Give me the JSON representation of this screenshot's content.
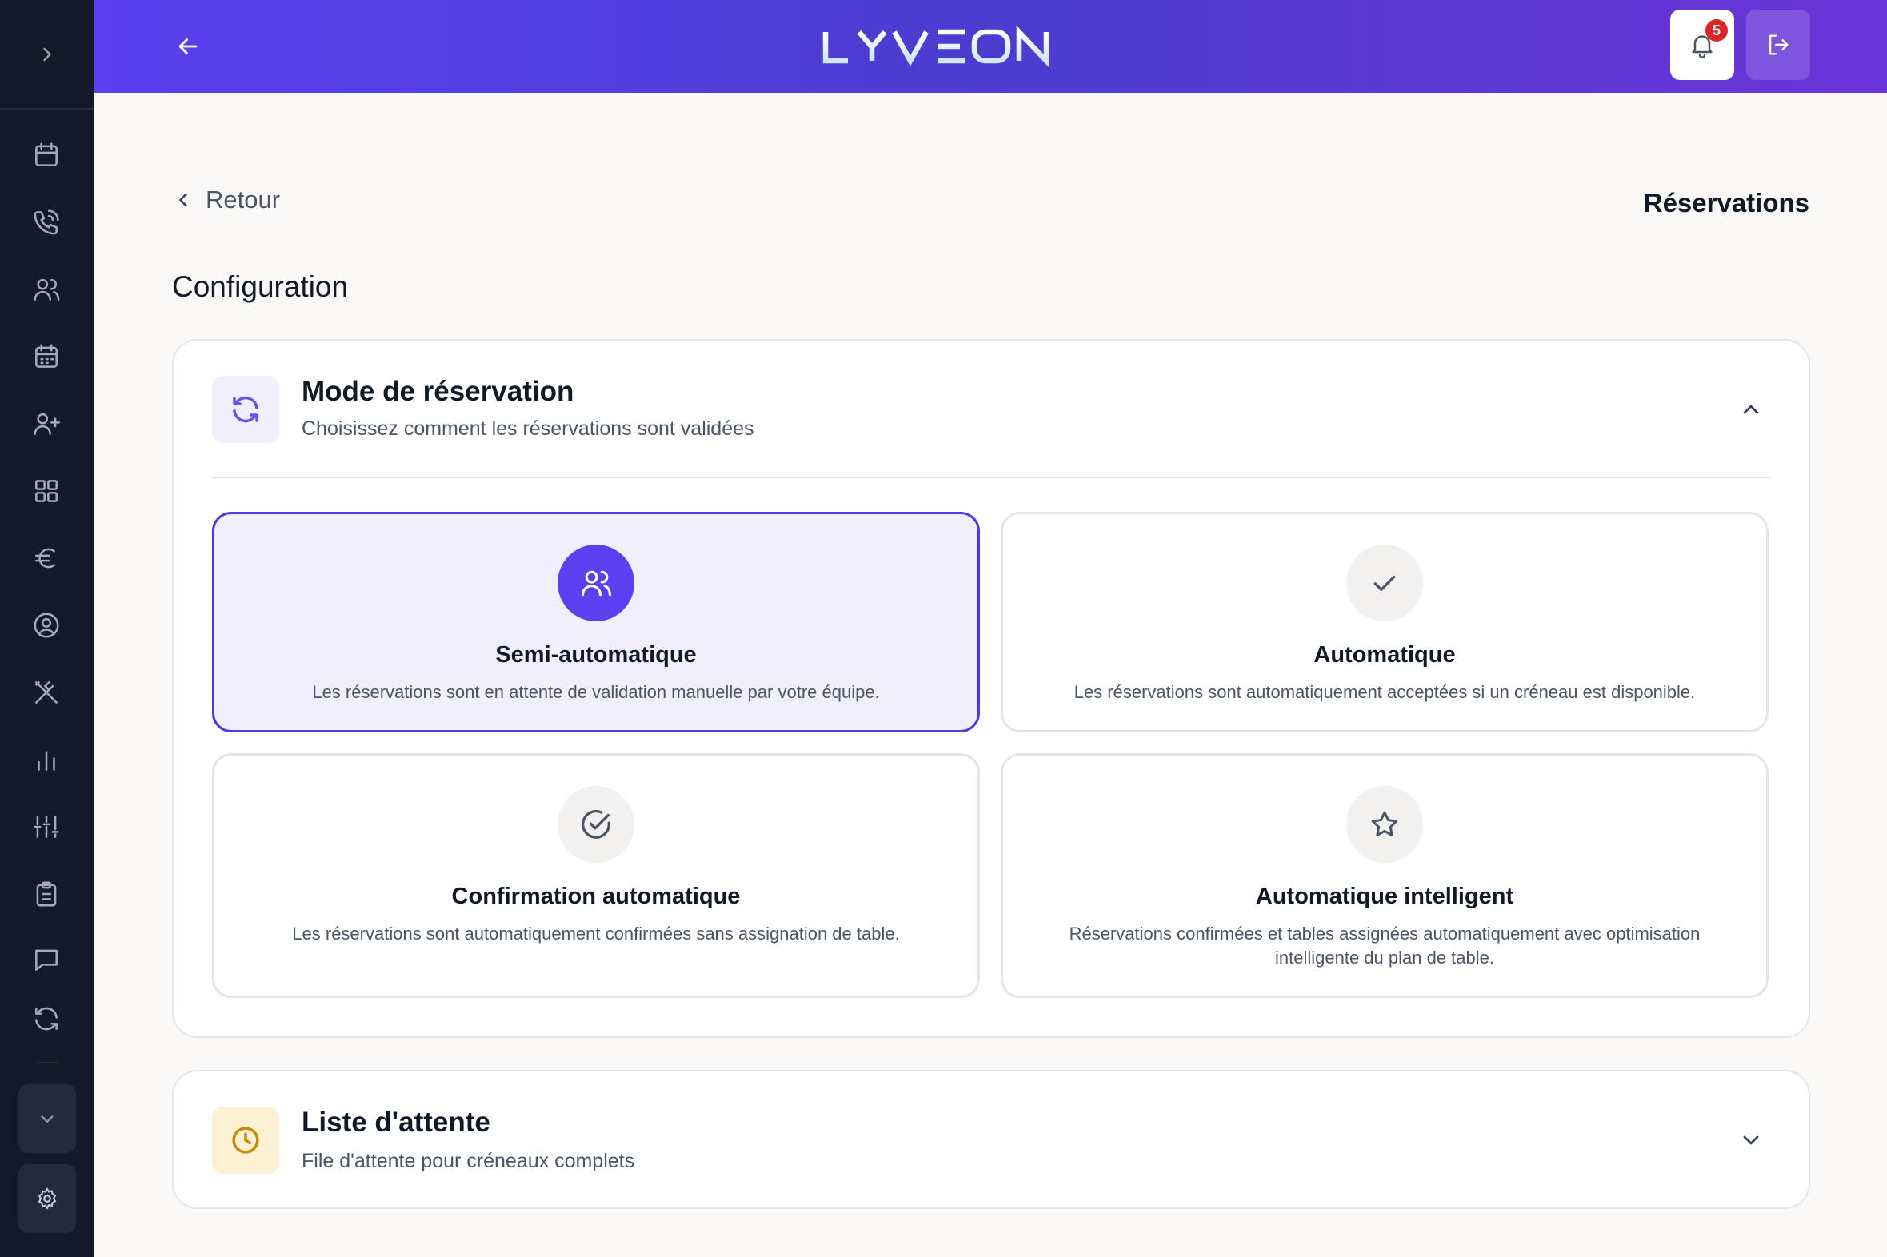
{
  "header": {
    "logo_text": "LYVEON",
    "notification_count": "5",
    "colors": {
      "gradient_start": "#5b3ff0",
      "gradient_end": "#6a34d8"
    }
  },
  "sidebar": {
    "toggle_icon": "chevron-right-icon",
    "items": [
      {
        "icon": "calendar-icon"
      },
      {
        "icon": "phone-call-icon"
      },
      {
        "icon": "users-icon"
      },
      {
        "icon": "calendar-grid-icon"
      },
      {
        "icon": "user-plus-icon"
      },
      {
        "icon": "grid-icon"
      },
      {
        "icon": "euro-icon"
      },
      {
        "icon": "user-circle-icon"
      },
      {
        "icon": "utensils-crossed-icon"
      },
      {
        "icon": "bar-chart-icon"
      },
      {
        "icon": "sliders-icon"
      },
      {
        "icon": "clipboard-icon"
      },
      {
        "icon": "message-square-icon"
      },
      {
        "icon": "refresh-icon"
      }
    ],
    "bottom": [
      {
        "icon": "chevron-down-icon"
      },
      {
        "icon": "settings-icon"
      }
    ]
  },
  "nav": {
    "back_label": "Retour",
    "page_title": "Réservations"
  },
  "section_title": "Configuration",
  "mode_card": {
    "title": "Mode de réservation",
    "subtitle": "Choisissez comment les réservations sont validées",
    "expanded": true,
    "options": [
      {
        "title": "Semi-automatique",
        "desc": "Les réservations sont en attente de validation manuelle par votre équipe.",
        "icon": "users-icon",
        "selected": true
      },
      {
        "title": "Automatique",
        "desc": "Les réservations sont automatiquement acceptées si un créneau est disponible.",
        "icon": "check-icon",
        "selected": false
      },
      {
        "title": "Confirmation automatique",
        "desc": "Les réservations sont automatiquement confirmées sans assignation de table.",
        "icon": "check-circle-icon",
        "selected": false
      },
      {
        "title": "Automatique intelligent",
        "desc": "Réservations confirmées et tables assignées automatiquement avec optimisation intelligente du plan de table.",
        "icon": "star-icon",
        "selected": false
      }
    ]
  },
  "waitlist_card": {
    "title": "Liste d'attente",
    "subtitle": "File d'attente pour créneaux complets",
    "expanded": false
  },
  "colors": {
    "accent": "#5038e6",
    "selected_bg": "#f1effd",
    "waitlist_icon_bg": "#fdf1d3",
    "waitlist_icon": "#c98a0c"
  }
}
